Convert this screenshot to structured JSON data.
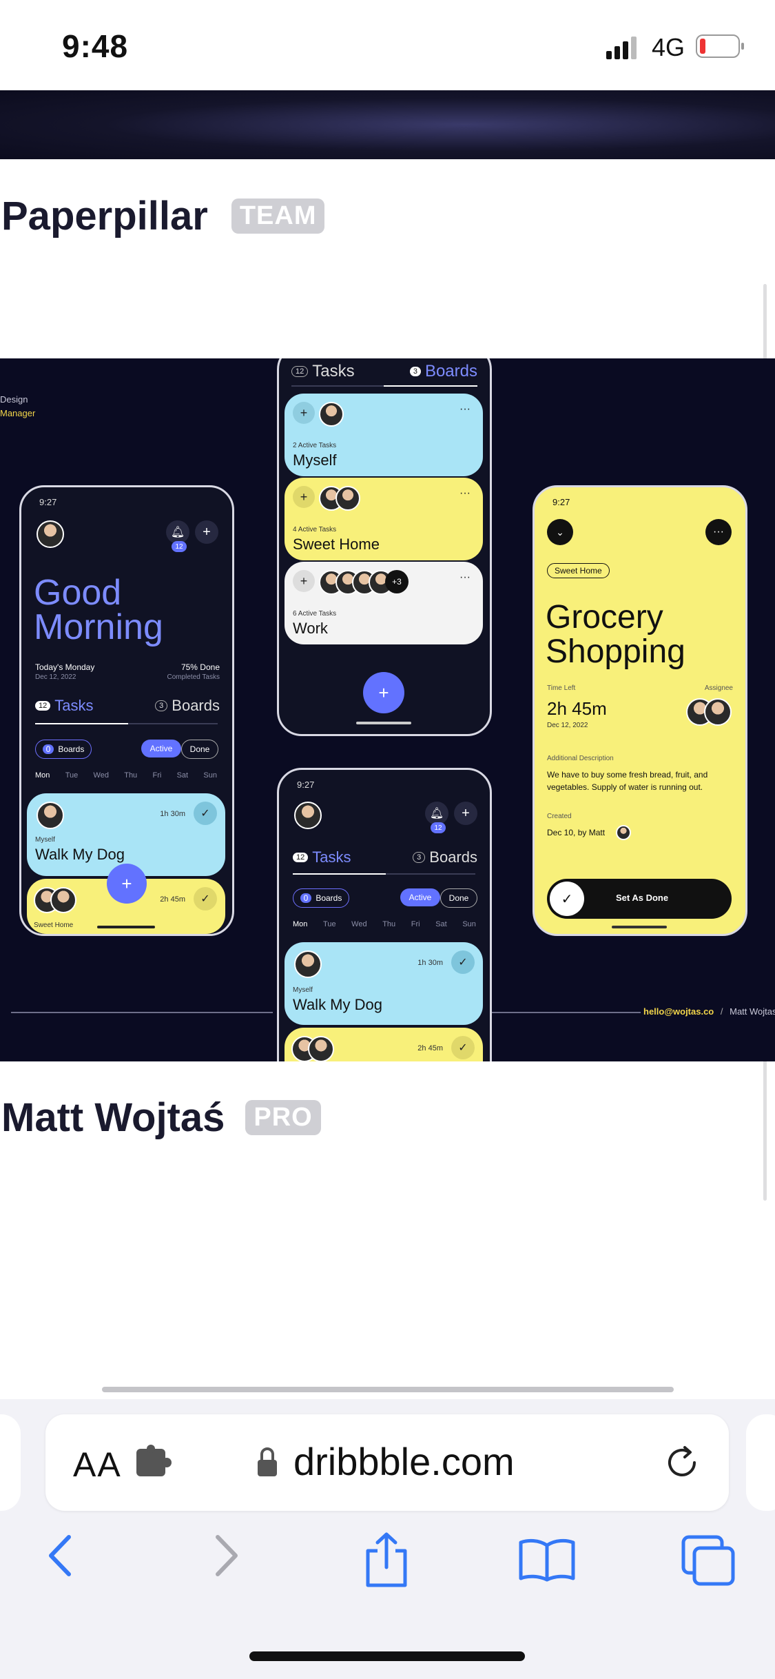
{
  "status_bar": {
    "time": "9:48",
    "network": "4G"
  },
  "shots": [
    {
      "title": "Paperpillar",
      "badge": "TEAM"
    },
    {
      "title": "Matt Wojtaś",
      "badge": "PRO"
    }
  ],
  "shot_image": {
    "side_text": [
      "Design",
      "Manager"
    ],
    "footer_email": "hello@wojtas.co",
    "footer_separator": "/",
    "footer_name": "Matt Wojtas",
    "phone_left": {
      "time": "9:27",
      "notif_count": "12",
      "greeting": "Good Morning",
      "today": "Today's Monday",
      "date": "Dec 12, 2022",
      "done_pct": "75% Done",
      "done_label": "Completed Tasks",
      "tasks_count": "12",
      "tasks_label": "Tasks",
      "boards_count": "3",
      "boards_label": "Boards",
      "filter_count": "0",
      "filter_label": "Boards",
      "seg_active": "Active",
      "seg_done": "Done",
      "days": [
        "Mon",
        "Tue",
        "Wed",
        "Thu",
        "Fri",
        "Sat",
        "Sun"
      ],
      "card1": {
        "sub": "Myself",
        "title": "Walk My Dog",
        "time": "1h 30m"
      },
      "card2": {
        "sub": "Sweet Home",
        "time": "2h 45m"
      }
    },
    "phone_mid_top": {
      "tasks_count": "12",
      "tasks_label": "Tasks",
      "boards_count": "3",
      "boards_label": "Boards",
      "boards": [
        {
          "sub": "2 Active Tasks",
          "title": "Myself",
          "more": "···"
        },
        {
          "sub": "4 Active Tasks",
          "title": "Sweet Home",
          "more": "···"
        },
        {
          "sub": "6 Active Tasks",
          "title": "Work",
          "more": "···",
          "extra": "+3"
        }
      ]
    },
    "phone_mid_bottom": {
      "time": "9:27",
      "notif_count": "12",
      "tasks_count": "12",
      "tasks_label": "Tasks",
      "boards_count": "3",
      "boards_label": "Boards",
      "filter_count": "0",
      "filter_label": "Boards",
      "seg_active": "Active",
      "seg_done": "Done",
      "days": [
        "Mon",
        "Tue",
        "Wed",
        "Thu",
        "Fri",
        "Sat",
        "Sun"
      ],
      "card1": {
        "sub": "Myself",
        "title": "Walk My Dog",
        "time": "1h 30m"
      },
      "card2": {
        "time": "2h 45m"
      }
    },
    "phone_right": {
      "time": "9:27",
      "board_tag": "Sweet Home",
      "title": "Grocery Shopping",
      "time_left_label": "Time Left",
      "assignee_label": "Assignee",
      "time_left": "2h 45m",
      "date": "Dec 12, 2022",
      "desc_label": "Additional Description",
      "desc": "We have to buy some fresh bread, fruit, and vegetables. Supply of water is running out.",
      "created_label": "Created",
      "created": "Dec 10, by Matt",
      "cta": "Set As Done"
    }
  },
  "browser": {
    "text_size_label": "AA",
    "url": "dribbble.com"
  },
  "colors": {
    "accent": "#6272ff",
    "yellow": "#f8f07a",
    "blue": "#a9e4f6",
    "dark": "#0a0b22"
  }
}
